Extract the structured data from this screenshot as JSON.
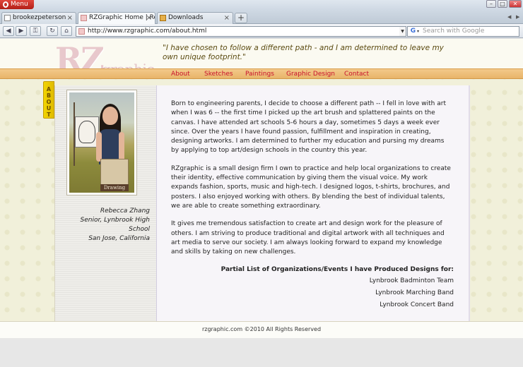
{
  "browser": {
    "menu_label": "Menu",
    "tabs": [
      {
        "label": "brookezpeterson"
      },
      {
        "label": "RZGraphic Home | Reb..."
      },
      {
        "label": "Downloads"
      }
    ],
    "new_tab_label": "+",
    "address": "http://www.rzgraphic.com/about.html",
    "search_placeholder": "Search with Google",
    "search_engine_icon": "G"
  },
  "site": {
    "logo_main": "RZ",
    "logo_sub": "graphic",
    "quote": "\"I have chosen to follow a different path - and I am determined to leave my own unique footprint.\"",
    "nav": [
      "About",
      "Sketches",
      "Paintings",
      "Graphic Design",
      "Contact"
    ],
    "side_tab": [
      "A",
      "B",
      "O",
      "U",
      "T"
    ],
    "photo_pad_label": "Drawing",
    "caption": [
      "Rebecca Zhang",
      "Senior, Lynbrook High School",
      "San Jose, California"
    ],
    "paragraphs": [
      "Born to engineering parents, I decide to choose a different path -- I fell in love with art when I was 6 -- the first time I picked up the art brush and splattered paints on the canvas. I have attended art schools 5-6 hours a day, sometimes 5 days a week ever since. Over the years I have found passion, fulfillment and inspiration in creating, designing artworks. I am determined to further my education and pursing my dreams by applying to top art/design schools in the country this year.",
      "RZgraphic is a small design firm I own to practice and help local organizations to create their identity, effective communication by giving them the visual voice. My work expands fashion, sports, music and high-tech. I designed logos, t-shirts, brochures, and posters. I also enjoyed working with others. By blending the best of individual talents, we are able to create something extraordinary.",
      "It gives me tremendous satisfaction to create art and design work for the pleasure of others. I am striving to produce traditional and digital artwork with all techniques and art media to serve our society. I am always looking forward to expand my knowledge and skills by taking on new challenges."
    ],
    "list_title": "Partial List of Organizations/Events I have Produced Designs for:",
    "list_items": [
      "Lynbrook Badminton Team",
      "Lynbrook Marching Band",
      "Lynbrook Concert Band"
    ],
    "footer": "rzgraphic.com ©2010 All Rights Reserved"
  }
}
